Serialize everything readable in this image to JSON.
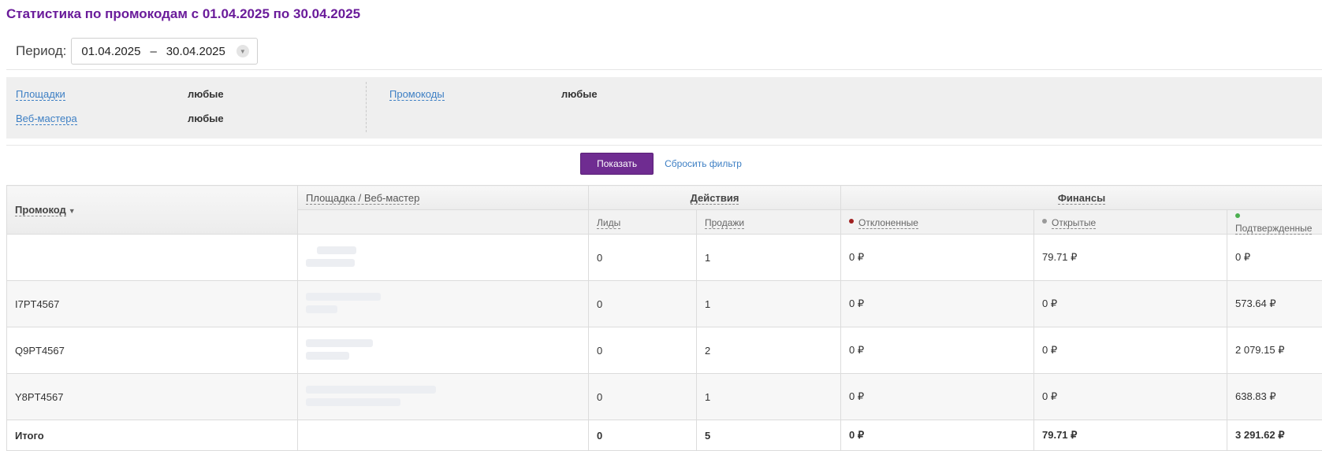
{
  "title": "Статистика по промокодам с 01.04.2025 по 30.04.2025",
  "period": {
    "label": "Период:",
    "from": "01.04.2025",
    "separator": "–",
    "to": "30.04.2025"
  },
  "filters": {
    "platforms": {
      "label": "Площадки",
      "value": "любые"
    },
    "webmasters": {
      "label": "Веб-мастера",
      "value": "любые"
    },
    "promocodes": {
      "label": "Промокоды",
      "value": "любые"
    }
  },
  "buttons": {
    "show": "Показать",
    "reset": "Сбросить фильтр"
  },
  "table": {
    "headers": {
      "promocode": "Промокод",
      "platform": "Площадка / Веб-мастер",
      "actions": "Действия",
      "finance": "Финансы",
      "leads": "Лиды",
      "sales": "Продажи",
      "rejected": "Отклоненные",
      "open": "Открытые",
      "confirmed": "Подтвержденные"
    },
    "status_colors": {
      "rejected": "#a02020",
      "open": "#9a9a9a",
      "confirmed": "#4caf50"
    },
    "rows": [
      {
        "promocode": "",
        "leads": "0",
        "sales": "1",
        "rejected": "0 ₽",
        "open": "79.71 ₽",
        "confirmed": "0 ₽"
      },
      {
        "promocode": "I7PT4567",
        "leads": "0",
        "sales": "1",
        "rejected": "0 ₽",
        "open": "0 ₽",
        "confirmed": "573.64 ₽"
      },
      {
        "promocode": "Q9PT4567",
        "leads": "0",
        "sales": "2",
        "rejected": "0 ₽",
        "open": "0 ₽",
        "confirmed": "2 079.15 ₽"
      },
      {
        "promocode": "Y8PT4567",
        "leads": "0",
        "sales": "1",
        "rejected": "0 ₽",
        "open": "0 ₽",
        "confirmed": "638.83 ₽"
      }
    ],
    "total": {
      "label": "Итого",
      "leads": "0",
      "sales": "5",
      "rejected": "0 ₽",
      "open": "79.71 ₽",
      "confirmed": "3 291.62 ₽"
    }
  },
  "colors": {
    "title": "#6a1b9a",
    "button": "#6f2c91",
    "link": "#3d7fc4"
  }
}
